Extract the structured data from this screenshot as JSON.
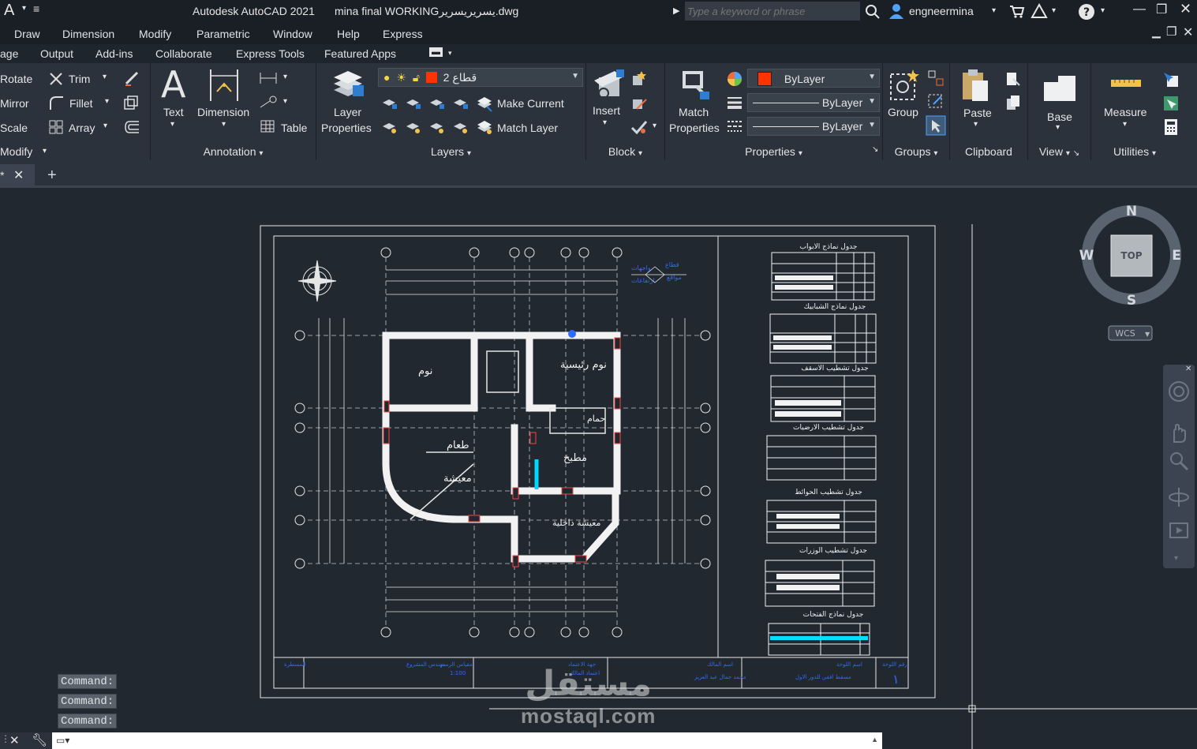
{
  "titlebar": {
    "app_logo": "A",
    "app_title": "Autodesk AutoCAD 2021",
    "file_name": "mina final WORKINGيسريريسرير.dwg",
    "search_placeholder": "Type a keyword or phrase",
    "user": "engneermina"
  },
  "menubar": [
    "Draw",
    "Dimension",
    "Modify",
    "Parametric",
    "Window",
    "Help",
    "Express"
  ],
  "ribbon_tabs": [
    "age",
    "Output",
    "Add-ins",
    "Collaborate",
    "Express Tools",
    "Featured Apps"
  ],
  "ribbon": {
    "modify": {
      "rotate": "Rotate",
      "trim": "Trim",
      "mirror": "Mirror",
      "fillet": "Fillet",
      "scale": "Scale",
      "array": "Array",
      "label": "Modify"
    },
    "annotation": {
      "text": "Text",
      "dimension": "Dimension",
      "table": "Table",
      "label": "Annotation"
    },
    "layers": {
      "layer_properties_1": "Layer",
      "layer_properties_2": "Properties",
      "current_layer": "قطاع 2",
      "make_current": "Make Current",
      "match_layer": "Match Layer",
      "label": "Layers"
    },
    "block": {
      "insert": "Insert",
      "label": "Block"
    },
    "properties": {
      "match_1": "Match",
      "match_2": "Properties",
      "color": "ByLayer",
      "linetype": "ByLayer",
      "lineweight": "ByLayer",
      "label": "Properties"
    },
    "groups": {
      "group": "Group",
      "label": "Groups"
    },
    "clipboard": {
      "paste": "Paste",
      "label": "Clipboard"
    },
    "view": {
      "base": "Base",
      "label": "View"
    },
    "utilities": {
      "measure": "Measure",
      "label": "Utilities"
    }
  },
  "viewcube": {
    "n": "N",
    "s": "S",
    "e": "E",
    "w": "W",
    "top": "TOP",
    "wcs": "WCS"
  },
  "command_history": [
    "Command:",
    "Command:",
    "Command:"
  ],
  "watermark": {
    "arabic": "مستقل",
    "latin": "mostaql.com"
  },
  "drawing": {
    "room_labels": [
      "نوم",
      "نوم رئيسية",
      "طعام",
      "معيشة",
      "مطبخ",
      "حمام",
      "معيشة داخلية"
    ],
    "schedule_titles": [
      "جدول نماذج الابواب",
      "جدول نماذج الشبابيك",
      "جدول تشطيب الاسقف",
      "جدول تشطيب الارضيات",
      "جدول تشطيب الحوائط",
      "جدول تشطيب الوزرات",
      "جدول نماذج الفتحات"
    ],
    "legend": [
      "قطاع",
      "مواقع",
      "واجهات",
      "ارتفاعات"
    ]
  }
}
